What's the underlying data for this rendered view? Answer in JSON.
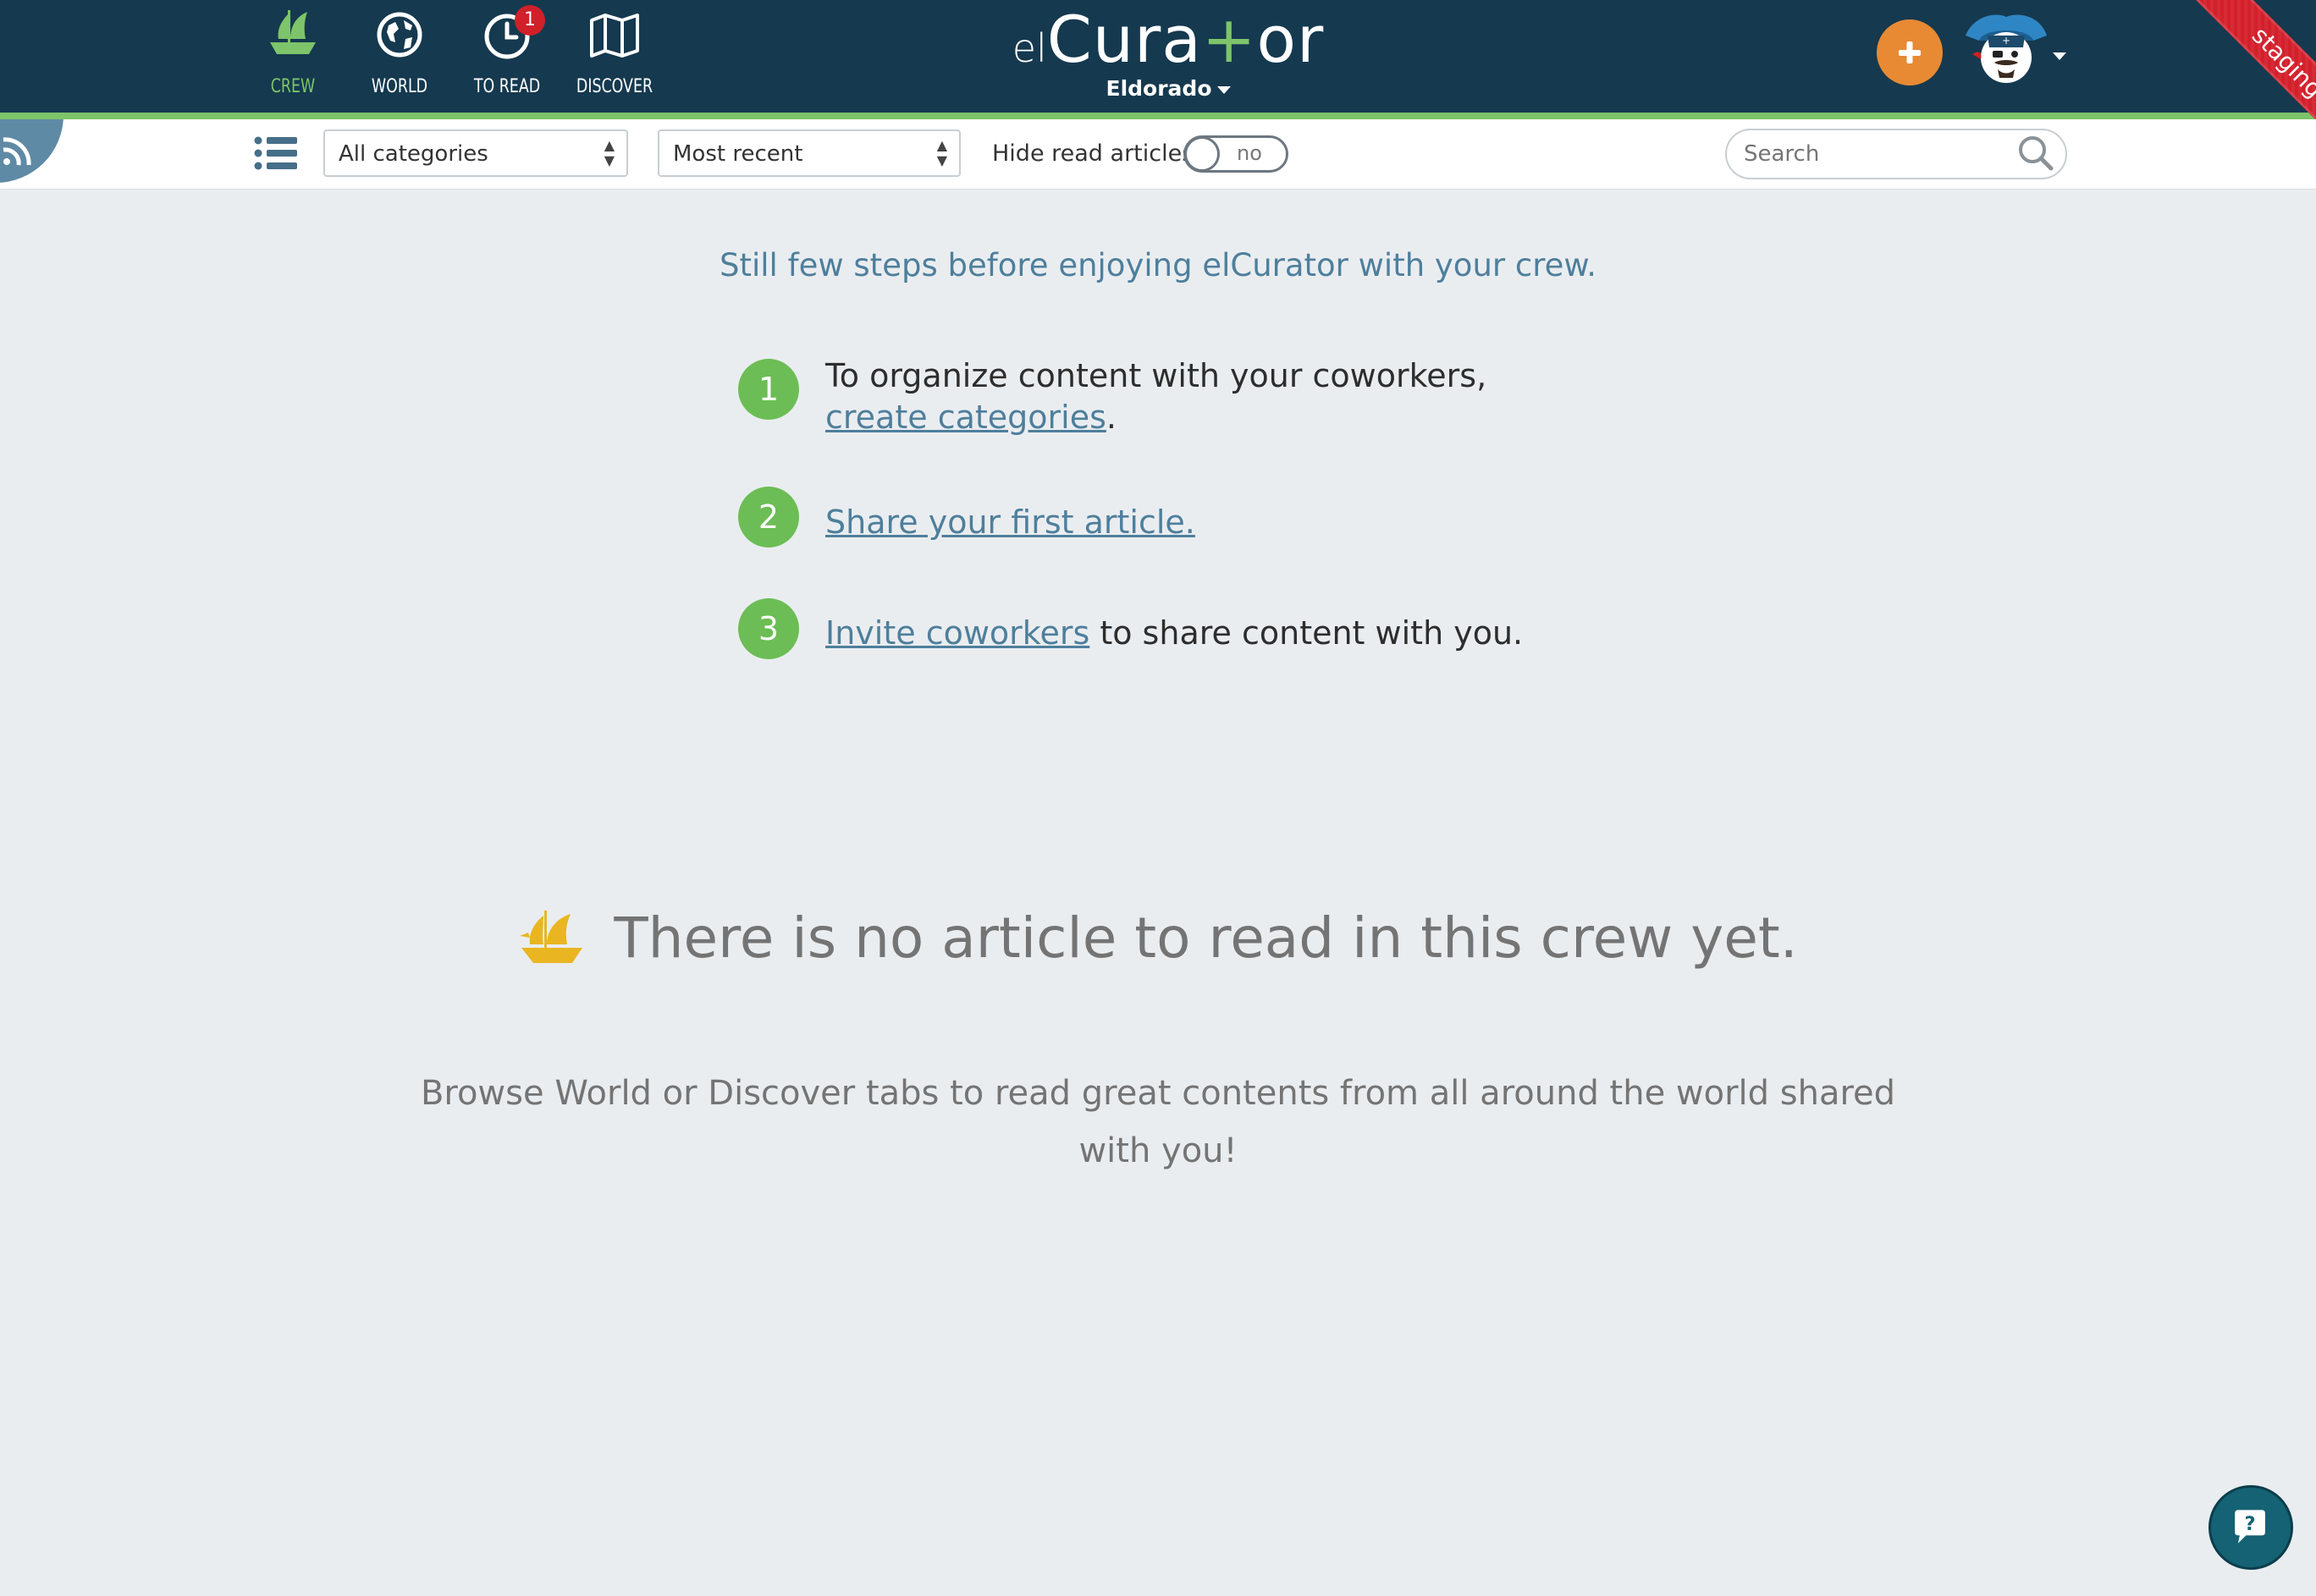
{
  "nav": {
    "items": [
      {
        "label": "CREW",
        "icon": "ship-icon",
        "active": true
      },
      {
        "label": "WORLD",
        "icon": "globe-icon",
        "active": false
      },
      {
        "label": "TO READ",
        "icon": "clock-icon",
        "active": false,
        "badge": "1"
      },
      {
        "label": "DISCOVER",
        "icon": "map-icon",
        "active": false
      }
    ]
  },
  "logo": {
    "prefix": "el",
    "main_a": "Cura",
    "main_plus": "+",
    "main_b": "or"
  },
  "crew": {
    "name": "Eldorado"
  },
  "ribbon": {
    "label": "staging"
  },
  "toolbar": {
    "category_select": "All categories",
    "sort_select": "Most recent",
    "hide_read_label": "Hide read articles",
    "toggle_value": "no",
    "search_placeholder": "Search"
  },
  "onboarding": {
    "intro": "Still few steps before enjoying elCurator with your crew.",
    "steps": [
      {
        "number": "1",
        "text_before": "To organize content with your coworkers, ",
        "link": "create categories",
        "text_after": "."
      },
      {
        "number": "2",
        "text_before": "",
        "link": "Share your first article.",
        "text_after": ""
      },
      {
        "number": "3",
        "text_before": "",
        "link": "Invite coworkers",
        "text_after": " to share content with you."
      }
    ]
  },
  "empty_state": {
    "title": "There is no article to read in this crew yet.",
    "subtitle": "Browse World or Discover tabs to read great contents from all around the world shared with you!"
  },
  "colors": {
    "header_bg": "#15394f",
    "accent_green": "#7dc46a",
    "link_blue": "#4e7f9c",
    "add_orange": "#e88a33",
    "ribbon_red": "#d3202b",
    "ship_gold": "#e9b622"
  }
}
